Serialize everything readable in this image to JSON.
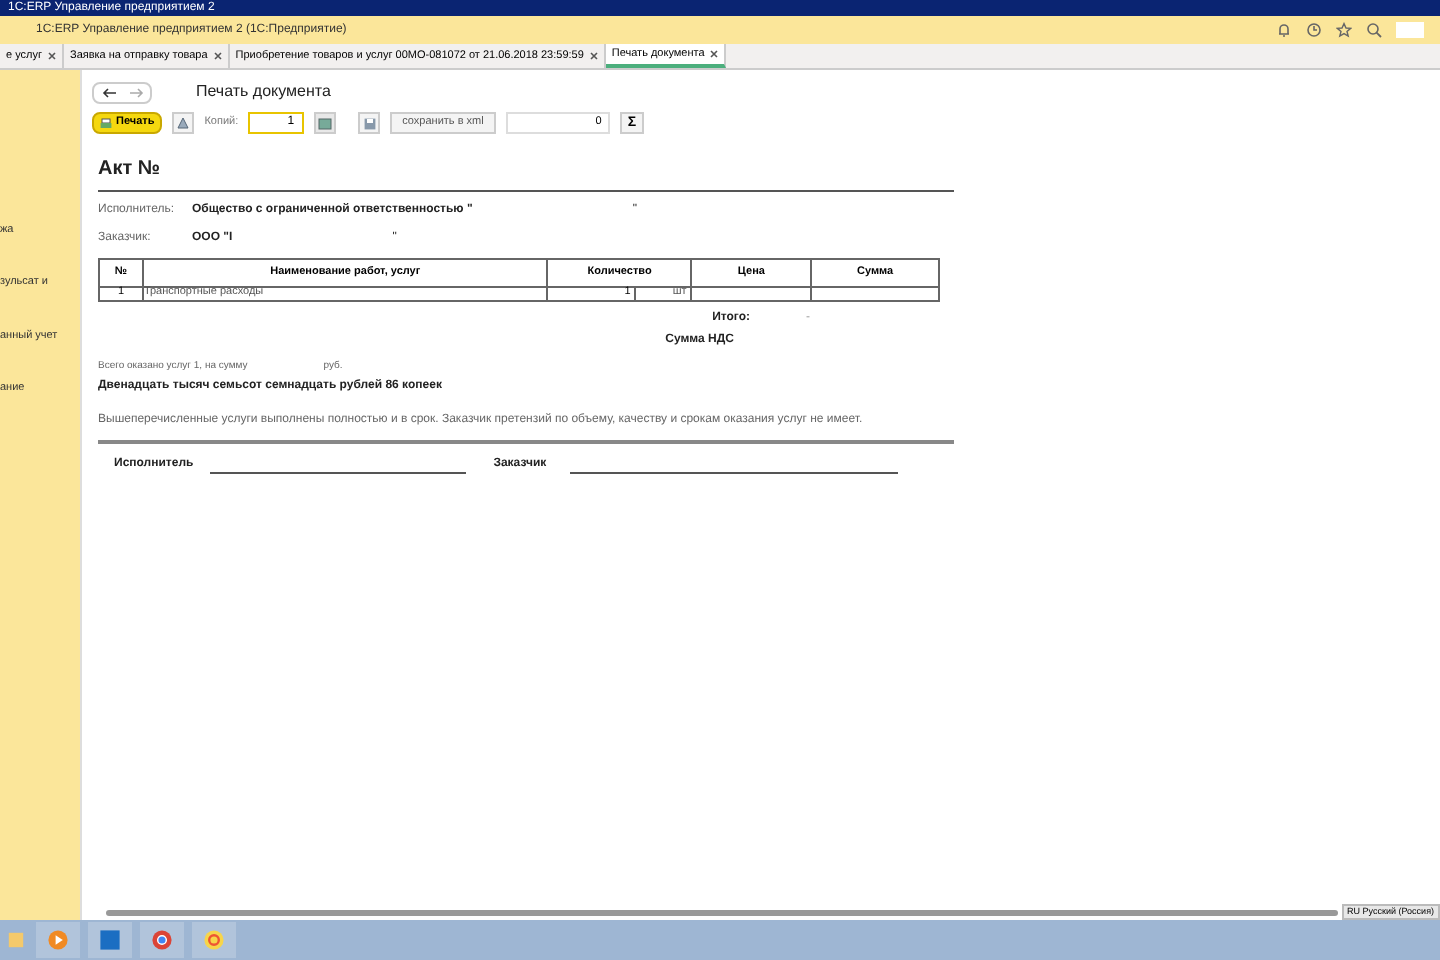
{
  "window": {
    "title": "1С:ERP Управление предприятием 2"
  },
  "app_bar": {
    "title": "1С:ERP Управление предприятием 2  (1С:Предприятие)"
  },
  "tabs": [
    {
      "label": "е услуг",
      "selected": false
    },
    {
      "label": "Заявка на отправку товара",
      "selected": false
    },
    {
      "label": "Приобретение товаров и услуг 00МО-081072 от 21.06.2018 23:59:59",
      "selected": false
    },
    {
      "label": "Печать документа",
      "selected": true
    }
  ],
  "sidebar": {
    "items": [
      "жа",
      "зульсат и",
      "анный учет",
      "ание"
    ]
  },
  "page": {
    "title": "Печать документа",
    "print_button": "Печать",
    "copies_label": "Копий:",
    "copies_value": "1",
    "save_button": "сохранить в xml",
    "sum_value": "0",
    "sigma": "Σ"
  },
  "document": {
    "title": "Акт №",
    "executor_label": "Исполнитель:",
    "executor": "Общество с ограниченной ответственностью \"",
    "executor_end": "\"",
    "customer_label": "Заказчик:",
    "customer": "ООО \"І",
    "customer_end": "\"",
    "table": {
      "columns": [
        "№",
        "Наименование работ, услуг",
        "Количество",
        "Цена",
        "Сумма"
      ],
      "rows": [
        {
          "num": "1",
          "name": "Транспортные расходы",
          "qty": "1",
          "unit": "шт"
        }
      ]
    },
    "total_label": "Итого:",
    "total_mark": "-",
    "vat_label": "Сумма НДС",
    "summary": "Всего оказано услуг 1, на сумму",
    "summary_unit": "руб.",
    "amount_words": "Двенадцать тысяч семьсот семнадцать рублей 86 копеек",
    "statement": "Вышеперечисленные услуги выполнены полностью и в срок. Заказчик претензий по объему, качеству и срокам оказания услуг не имеет.",
    "sign_executor": "Исполнитель",
    "sign_customer": "Заказчик"
  },
  "status": {
    "language": "RU Русский (Россия)"
  }
}
